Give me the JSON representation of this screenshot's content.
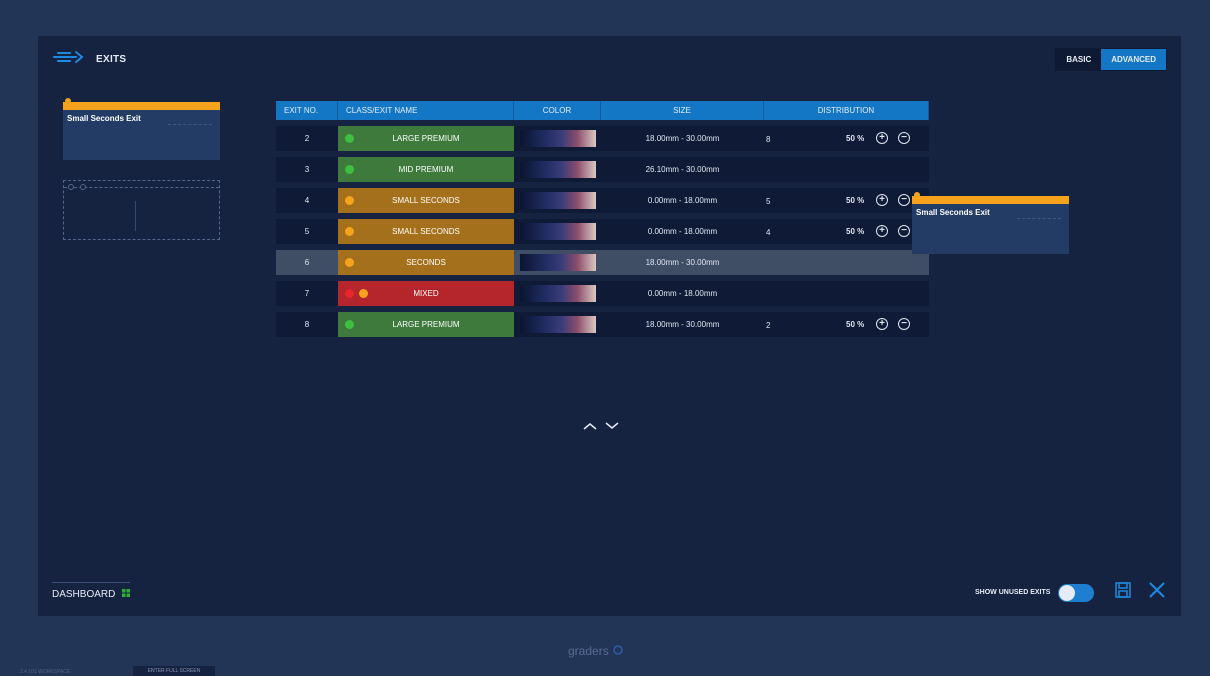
{
  "header": {
    "title": "EXITS",
    "icon": "exits-arrow-icon"
  },
  "mode": {
    "basic": "BASIC",
    "advanced": "ADVANCED",
    "selected": "ADVANCED"
  },
  "left_card": {
    "name": "Small Seconds Exit"
  },
  "drag_card": {
    "name": "Small Seconds Exit"
  },
  "table": {
    "headers": [
      "EXIT NO.",
      "CLASS/EXIT NAME",
      "COLOR",
      "SIZE",
      "DISTRIBUTION"
    ],
    "rows": [
      {
        "no": "2",
        "name": "LARGE PREMIUM",
        "cls": "green",
        "dots": [
          "#3fbf3f"
        ],
        "size": "18.00mm - 30.00mm",
        "count": "8",
        "pct": "50 %",
        "controls": true
      },
      {
        "no": "3",
        "name": "MID PREMIUM",
        "cls": "green",
        "dots": [
          "#3fbf3f"
        ],
        "size": "26.10mm - 30.00mm",
        "count": "",
        "pct": "",
        "controls": false
      },
      {
        "no": "4",
        "name": "SMALL SECONDS",
        "cls": "orange",
        "dots": [
          "#f5a31d"
        ],
        "size": "0.00mm - 18.00mm",
        "count": "5",
        "pct": "50 %",
        "controls": true
      },
      {
        "no": "5",
        "name": "SMALL SECONDS",
        "cls": "orange",
        "dots": [
          "#f5a31d"
        ],
        "size": "0.00mm - 18.00mm",
        "count": "4",
        "pct": "50 %",
        "controls": true
      },
      {
        "no": "6",
        "name": "SECONDS",
        "cls": "orange",
        "dots": [
          "#f5a31d"
        ],
        "size": "18.00mm - 30.00mm",
        "count": "",
        "pct": "",
        "controls": false,
        "selected": true
      },
      {
        "no": "7",
        "name": "MIXED",
        "cls": "red",
        "dots": [
          "#e8262c",
          "#f5a31d"
        ],
        "size": "0.00mm - 18.00mm",
        "count": "",
        "pct": "",
        "controls": false
      },
      {
        "no": "8",
        "name": "LARGE PREMIUM",
        "cls": "green",
        "dots": [
          "#3fbf3f"
        ],
        "size": "18.00mm - 30.00mm",
        "count": "2",
        "pct": "50 %",
        "controls": true
      }
    ]
  },
  "footer": {
    "dashboard": "DASHBOARD",
    "show_unused": "SHOW UNUSED EXITS",
    "brand": "graders",
    "version": "2.4.101 WORKSPACE",
    "fullscreen": "ENTER FULL SCREEN"
  },
  "colors": {
    "accent": "#1477c6",
    "orange": "#f5a31d",
    "green": "#3d7a3c",
    "red": "#b4262c"
  }
}
